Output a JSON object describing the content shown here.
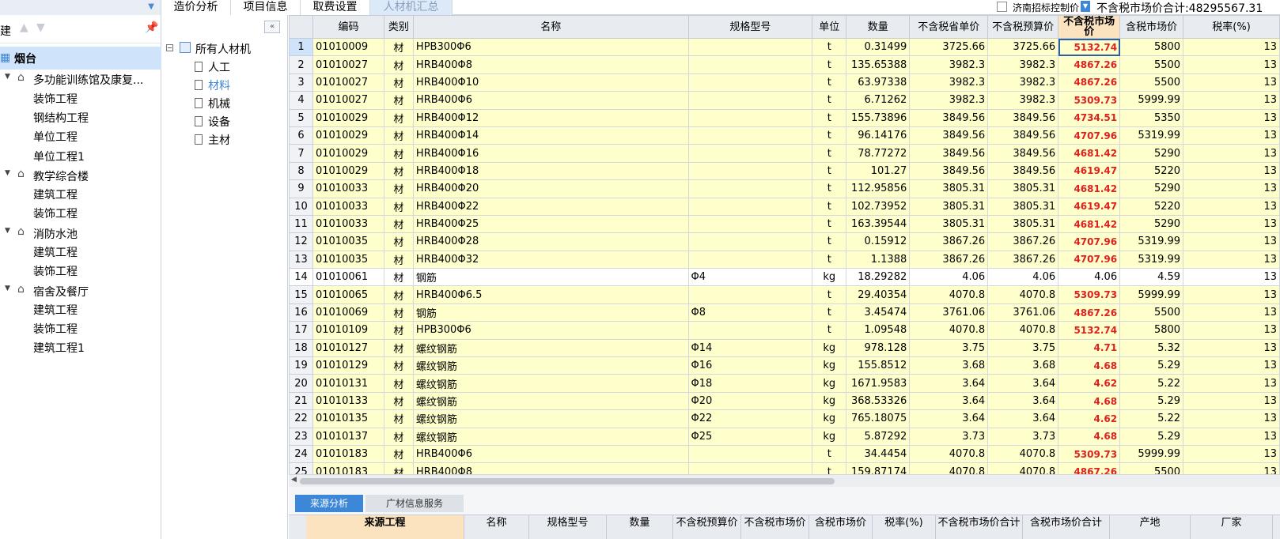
{
  "top_tabs": [
    {
      "label": "造价分析"
    },
    {
      "label": "项目信息"
    },
    {
      "label": "取费设置"
    },
    {
      "label": "人材机汇总"
    }
  ],
  "top_controls": {
    "checkbox_label": "济南招标控制价",
    "total_label": "不含税市场价合计:48295567.31"
  },
  "project_panel": {
    "toolbar_label": "建",
    "root": "烟台",
    "groups": [
      {
        "label": "多功能训练馆及康复...",
        "items": [
          "装饰工程",
          "钢结构工程",
          "单位工程",
          "单位工程1"
        ]
      },
      {
        "label": "教学综合楼",
        "items": [
          "建筑工程",
          "装饰工程"
        ]
      },
      {
        "label": "消防水池",
        "items": [
          "建筑工程",
          "装饰工程"
        ]
      },
      {
        "label": "宿舍及餐厅",
        "items": [
          "建筑工程",
          "装饰工程",
          "建筑工程1"
        ]
      }
    ]
  },
  "category_tree": {
    "root": "所有人材机",
    "items": [
      "人工",
      "材料",
      "机械",
      "设备",
      "主材"
    ],
    "selected": "材料"
  },
  "grid": {
    "headers": [
      "",
      "编码",
      "类别",
      "名称",
      "规格型号",
      "单位",
      "数量",
      "不含税省单价",
      "不含税预算价",
      "不含税市场价",
      "含税市场价",
      "税率(%)"
    ],
    "rows": [
      [
        "1",
        "01010009",
        "材",
        "HPB300Φ6",
        "",
        "t",
        "0.31499",
        "3725.66",
        "3725.66",
        "5132.74",
        "5800",
        "13"
      ],
      [
        "2",
        "01010027",
        "材",
        "HRB400Φ8",
        "",
        "t",
        "135.65388",
        "3982.3",
        "3982.3",
        "4867.26",
        "5500",
        "13"
      ],
      [
        "3",
        "01010027",
        "材",
        "HRB400Φ10",
        "",
        "t",
        "63.97338",
        "3982.3",
        "3982.3",
        "4867.26",
        "5500",
        "13"
      ],
      [
        "4",
        "01010027",
        "材",
        "HRB400Φ6",
        "",
        "t",
        "6.71262",
        "3982.3",
        "3982.3",
        "5309.73",
        "5999.99",
        "13"
      ],
      [
        "5",
        "01010029",
        "材",
        "HRB400Φ12",
        "",
        "t",
        "155.73896",
        "3849.56",
        "3849.56",
        "4734.51",
        "5350",
        "13"
      ],
      [
        "6",
        "01010029",
        "材",
        "HRB400Φ14",
        "",
        "t",
        "96.14176",
        "3849.56",
        "3849.56",
        "4707.96",
        "5319.99",
        "13"
      ],
      [
        "7",
        "01010029",
        "材",
        "HRB400Φ16",
        "",
        "t",
        "78.77272",
        "3849.56",
        "3849.56",
        "4681.42",
        "5290",
        "13"
      ],
      [
        "8",
        "01010029",
        "材",
        "HRB400Φ18",
        "",
        "t",
        "101.27",
        "3849.56",
        "3849.56",
        "4619.47",
        "5220",
        "13"
      ],
      [
        "9",
        "01010033",
        "材",
        "HRB400Φ20",
        "",
        "t",
        "112.95856",
        "3805.31",
        "3805.31",
        "4681.42",
        "5290",
        "13"
      ],
      [
        "10",
        "01010033",
        "材",
        "HRB400Φ22",
        "",
        "t",
        "102.73952",
        "3805.31",
        "3805.31",
        "4619.47",
        "5220",
        "13"
      ],
      [
        "11",
        "01010033",
        "材",
        "HRB400Φ25",
        "",
        "t",
        "163.39544",
        "3805.31",
        "3805.31",
        "4681.42",
        "5290",
        "13"
      ],
      [
        "12",
        "01010035",
        "材",
        "HRB400Φ28",
        "",
        "t",
        "0.15912",
        "3867.26",
        "3867.26",
        "4707.96",
        "5319.99",
        "13"
      ],
      [
        "13",
        "01010035",
        "材",
        "HRB400Φ32",
        "",
        "t",
        "1.1388",
        "3867.26",
        "3867.26",
        "4707.96",
        "5319.99",
        "13"
      ],
      [
        "14",
        "01010061",
        "材",
        "钢筋",
        "Φ4",
        "kg",
        "18.29282",
        "4.06",
        "4.06",
        "4.06",
        "4.59",
        "13"
      ],
      [
        "15",
        "01010065",
        "材",
        "HRB400Φ6.5",
        "",
        "t",
        "29.40354",
        "4070.8",
        "4070.8",
        "5309.73",
        "5999.99",
        "13"
      ],
      [
        "16",
        "01010069",
        "材",
        "钢筋",
        "Φ8",
        "t",
        "3.45474",
        "3761.06",
        "3761.06",
        "4867.26",
        "5500",
        "13"
      ],
      [
        "17",
        "01010109",
        "材",
        "HPB300Φ6",
        "",
        "t",
        "1.09548",
        "4070.8",
        "4070.8",
        "5132.74",
        "5800",
        "13"
      ],
      [
        "18",
        "01010127",
        "材",
        "螺纹钢筋",
        "Φ14",
        "kg",
        "978.128",
        "3.75",
        "3.75",
        "4.71",
        "5.32",
        "13"
      ],
      [
        "19",
        "01010129",
        "材",
        "螺纹钢筋",
        "Φ16",
        "kg",
        "155.8512",
        "3.68",
        "3.68",
        "4.68",
        "5.29",
        "13"
      ],
      [
        "20",
        "01010131",
        "材",
        "螺纹钢筋",
        "Φ18",
        "kg",
        "1671.9583",
        "3.64",
        "3.64",
        "4.62",
        "5.22",
        "13"
      ],
      [
        "21",
        "01010133",
        "材",
        "螺纹钢筋",
        "Φ20",
        "kg",
        "368.53326",
        "3.64",
        "3.64",
        "4.68",
        "5.29",
        "13"
      ],
      [
        "22",
        "01010135",
        "材",
        "螺纹钢筋",
        "Φ22",
        "kg",
        "765.18075",
        "3.64",
        "3.64",
        "4.62",
        "5.22",
        "13"
      ],
      [
        "23",
        "01010137",
        "材",
        "螺纹钢筋",
        "Φ25",
        "kg",
        "5.87292",
        "3.73",
        "3.73",
        "4.68",
        "5.29",
        "13"
      ],
      [
        "24",
        "01010183",
        "材",
        "HRB400Φ6",
        "",
        "t",
        "34.4454",
        "4070.8",
        "4070.8",
        "5309.73",
        "5999.99",
        "13"
      ],
      [
        "25",
        "01010183",
        "材",
        "HRB400Φ8",
        "",
        "t",
        "159.87174",
        "4070.8",
        "4070.8",
        "4867.26",
        "5500",
        "13"
      ]
    ],
    "red_rows": [
      "1",
      "2",
      "3",
      "4",
      "5",
      "6",
      "7",
      "8",
      "9",
      "10",
      "11",
      "12",
      "13",
      "15",
      "16",
      "17",
      "18",
      "19",
      "20",
      "21",
      "22",
      "23",
      "24",
      "25"
    ],
    "white_rows": [
      "14"
    ]
  },
  "bottom": {
    "tabs": [
      "来源分析",
      "广材信息服务"
    ],
    "headers": [
      "来源工程",
      "名称",
      "规格型号",
      "数量",
      "不含税预算价",
      "不含税市场价",
      "含税市场价",
      "税率(%)",
      "不含税市场价合计",
      "含税市场价合计",
      "产地",
      "厂家"
    ]
  },
  "colors": {
    "accent": "#3d87d8",
    "highlight_red": "#e02020",
    "row_yellow": "#ffffcc",
    "header_gray": "#e8ecf1",
    "selected_header": "#fbe3bf"
  }
}
